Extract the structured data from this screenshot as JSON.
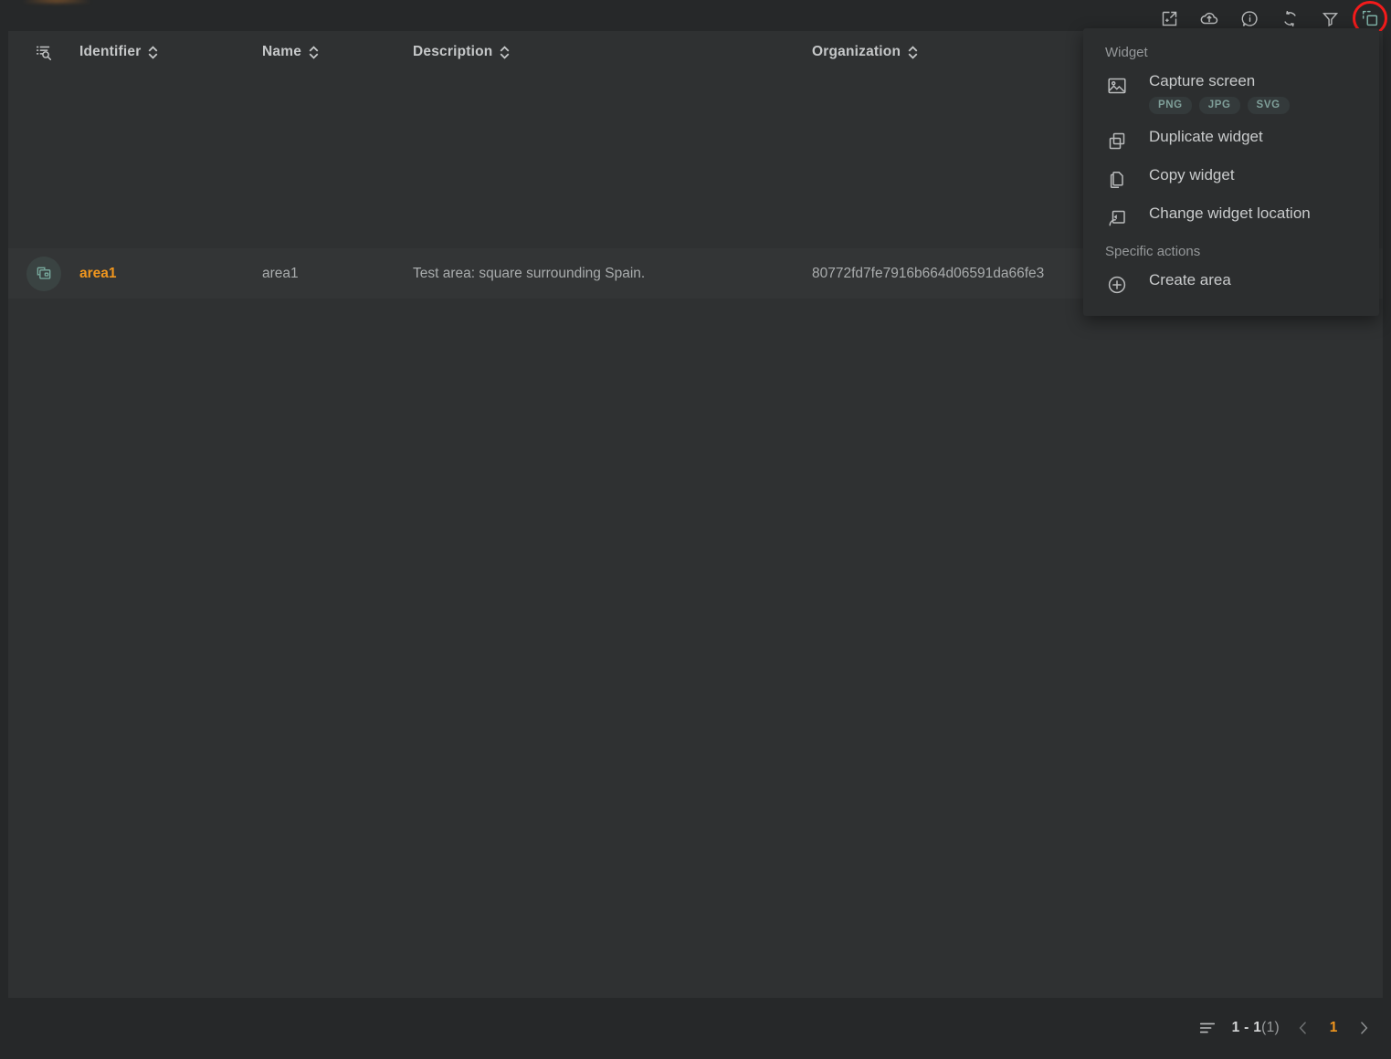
{
  "theme": {
    "page_bg": "#262829",
    "panel_bg": "#2f3132",
    "row_bg": "#333536",
    "menu_bg": "#2c2e2f",
    "accent_orange": "#f0961e",
    "accent_teal": "#7fb3a8",
    "highlight_ring": "#f31b1b",
    "text_primary": "#c9cbcc",
    "text_muted": "#95989a"
  },
  "toolbar": {
    "items": [
      {
        "name": "open-in-new-icon",
        "title": "Open in new window"
      },
      {
        "name": "upload-cloud-icon",
        "title": "Upload"
      },
      {
        "name": "info-icon",
        "title": "Information"
      },
      {
        "name": "refresh-icon",
        "title": "Refresh"
      },
      {
        "name": "filter-icon",
        "title": "Filter"
      },
      {
        "name": "widget-actions-icon",
        "title": "Widget actions"
      }
    ]
  },
  "table": {
    "search_icon": "list-search-icon",
    "columns": [
      {
        "label": "Identifier",
        "sortable": true
      },
      {
        "label": "Name",
        "sortable": true
      },
      {
        "label": "Description",
        "sortable": true
      },
      {
        "label": "Organization",
        "sortable": true
      }
    ],
    "rows": [
      {
        "row_icon": "layers-copy-icon",
        "identifier": "area1",
        "name": "area1",
        "description": "Test area: square surrounding Spain.",
        "organization": "80772fd7fe7916b664d06591da66fe3"
      }
    ]
  },
  "pagination": {
    "list_icon": "rows-icon",
    "range": "1 - 1",
    "total": "(1)",
    "prev_label": "‹",
    "current_page": "1",
    "next_label": "›"
  },
  "menu": {
    "groups": [
      {
        "title": "Widget",
        "items": [
          {
            "label": "Capture screen",
            "icon": "image-icon",
            "chips": [
              "PNG",
              "JPG",
              "SVG"
            ]
          },
          {
            "label": "Duplicate widget",
            "icon": "duplicate-icon",
            "chips": []
          },
          {
            "label": "Copy widget",
            "icon": "copy-icon",
            "chips": []
          },
          {
            "label": "Change widget location",
            "icon": "move-location-icon",
            "chips": []
          }
        ]
      },
      {
        "title": "Specific actions",
        "items": [
          {
            "label": "Create area",
            "icon": "plus-circle-icon",
            "chips": []
          }
        ]
      }
    ]
  }
}
